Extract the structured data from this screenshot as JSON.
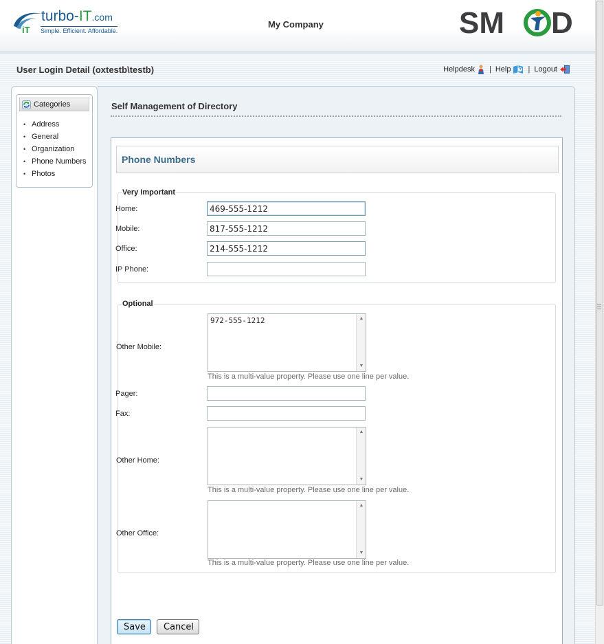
{
  "header": {
    "logo_left": {
      "brand_main": "turbo-",
      "brand_it": "IT",
      "brand_suffix": ".com",
      "tagline": "Simple.  Efficient.  Affordable.",
      "mark_text": "iT"
    },
    "company_name": "My Company",
    "logo_right": {
      "text_left": "SM",
      "text_right": "D"
    }
  },
  "titlebar": {
    "title": "User Login Detail (oxtestb\\testb)",
    "links": [
      {
        "label": "Helpdesk",
        "icon": "helpdesk-person-icon"
      },
      {
        "label": "Help",
        "icon": "help-book-icon"
      },
      {
        "label": "Logout",
        "icon": "logout-door-icon"
      }
    ],
    "separator": "|"
  },
  "sidebar": {
    "header": "Categories",
    "items": [
      "Address",
      "General",
      "Organization",
      "Phone Numbers",
      "Photos"
    ]
  },
  "main": {
    "title": "Self Management of Directory",
    "section_title": "Phone Numbers",
    "groups": {
      "very_important": {
        "legend": "Very Important",
        "fields": [
          {
            "label": "Home:",
            "value": "469-555-1212"
          },
          {
            "label": "Mobile:",
            "value": "817-555-1212"
          },
          {
            "label": "Office:",
            "value": "214-555-1212"
          },
          {
            "label": "IP Phone:",
            "value": ""
          }
        ]
      },
      "optional": {
        "legend": "Optional",
        "other_mobile": {
          "label": "Other Mobile:",
          "value": "972-555-1212"
        },
        "pager": {
          "label": "Pager:",
          "value": ""
        },
        "fax": {
          "label": "Fax:",
          "value": ""
        },
        "other_home": {
          "label": "Other Home:",
          "value": ""
        },
        "other_office": {
          "label": "Other Office:",
          "value": ""
        },
        "multi_value_hint": "This is a multi-value property. Please use one line per value."
      }
    },
    "buttons": {
      "save": "Save",
      "cancel": "Cancel"
    }
  },
  "colors": {
    "section_title": "#3a6d8c",
    "brand_blue": "#1c5b8f",
    "brand_green": "#2a9a3e"
  }
}
